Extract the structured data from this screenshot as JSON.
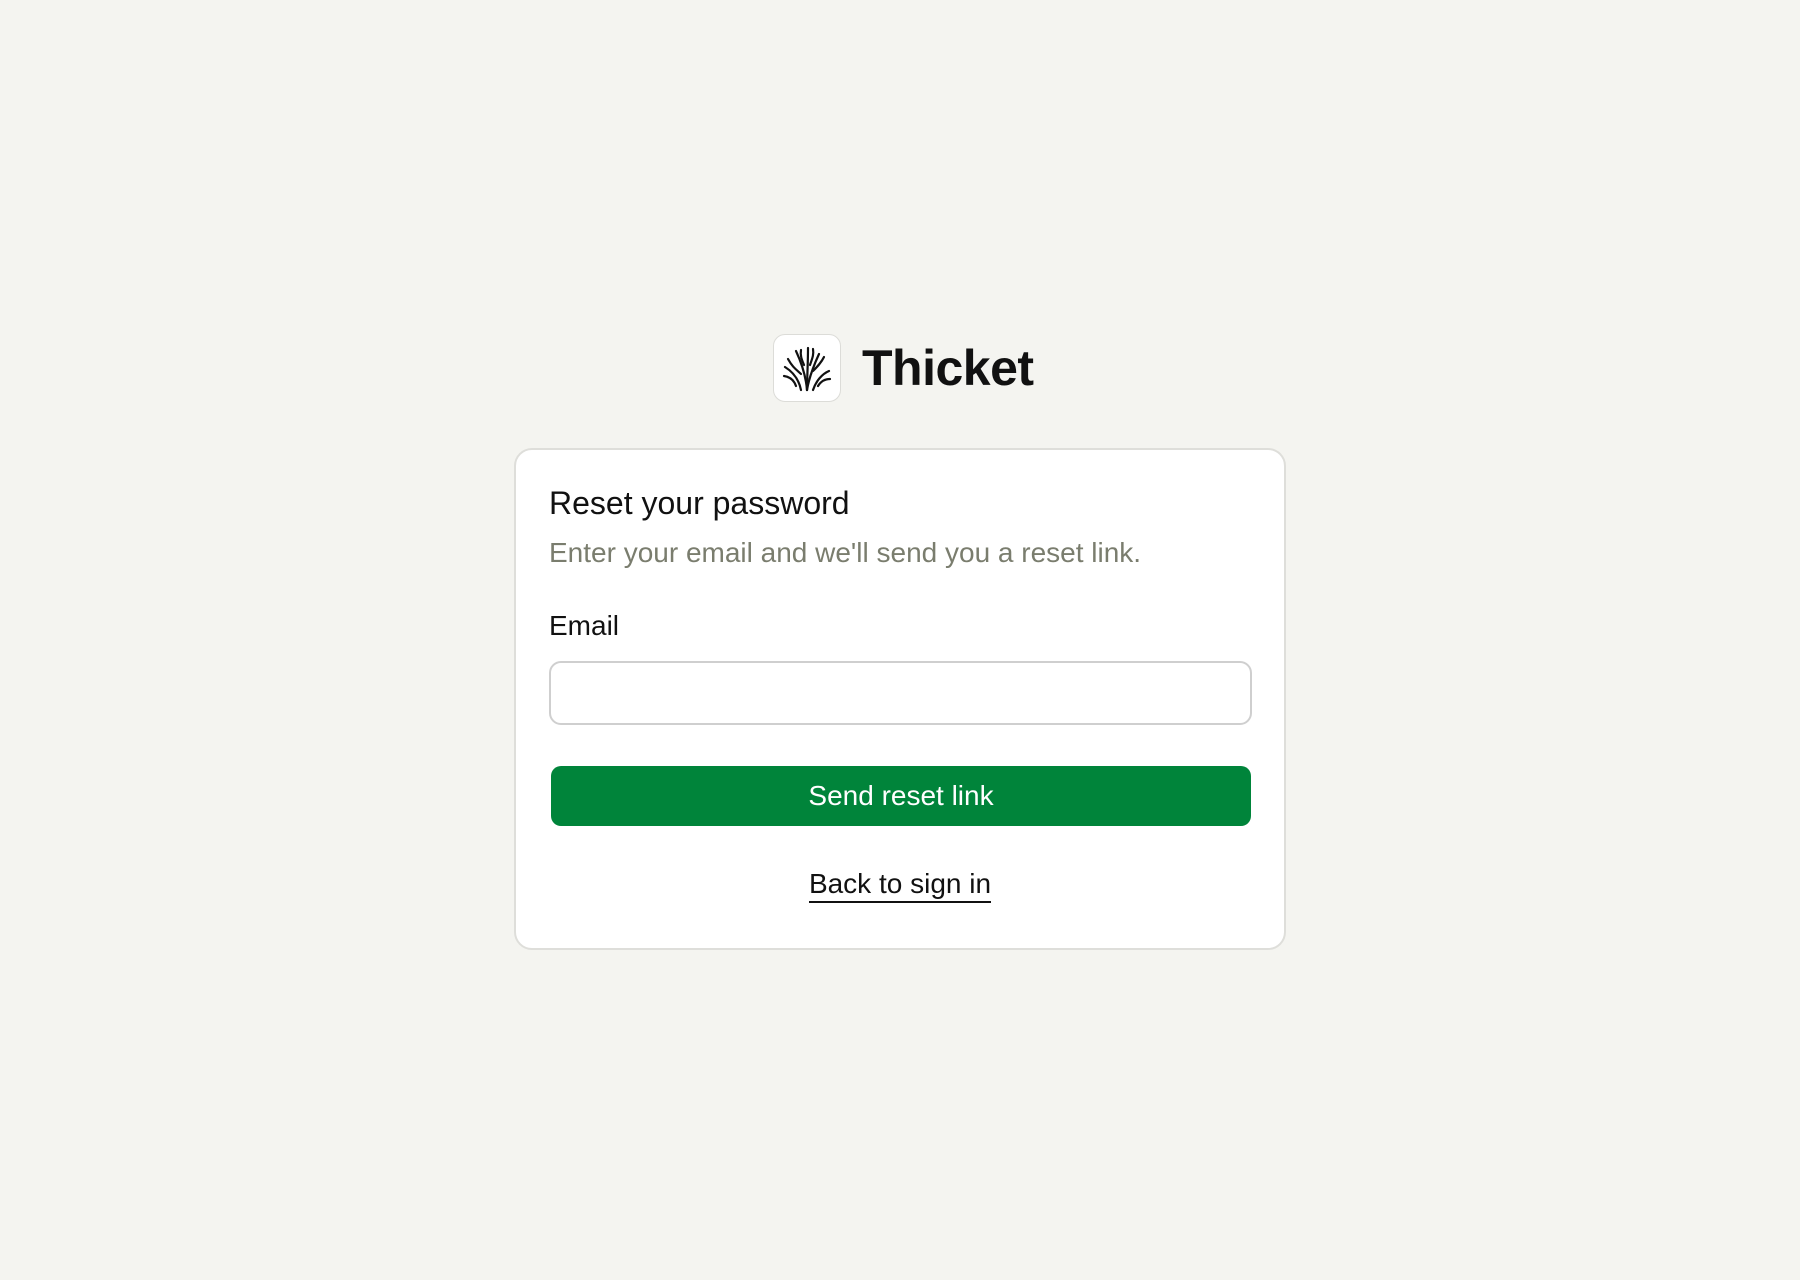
{
  "brand": {
    "name": "Thicket",
    "logo_icon": "thicket-logo-icon"
  },
  "reset_form": {
    "title": "Reset your password",
    "subtitle": "Enter your email and we'll send you a reset link.",
    "email_label": "Email",
    "email_value": "",
    "email_placeholder": "",
    "submit_label": "Send reset link",
    "back_link_label": "Back to sign in"
  },
  "colors": {
    "page_background": "#f4f4f0",
    "accent": "#00843a",
    "muted_text": "#7a7d6e"
  }
}
